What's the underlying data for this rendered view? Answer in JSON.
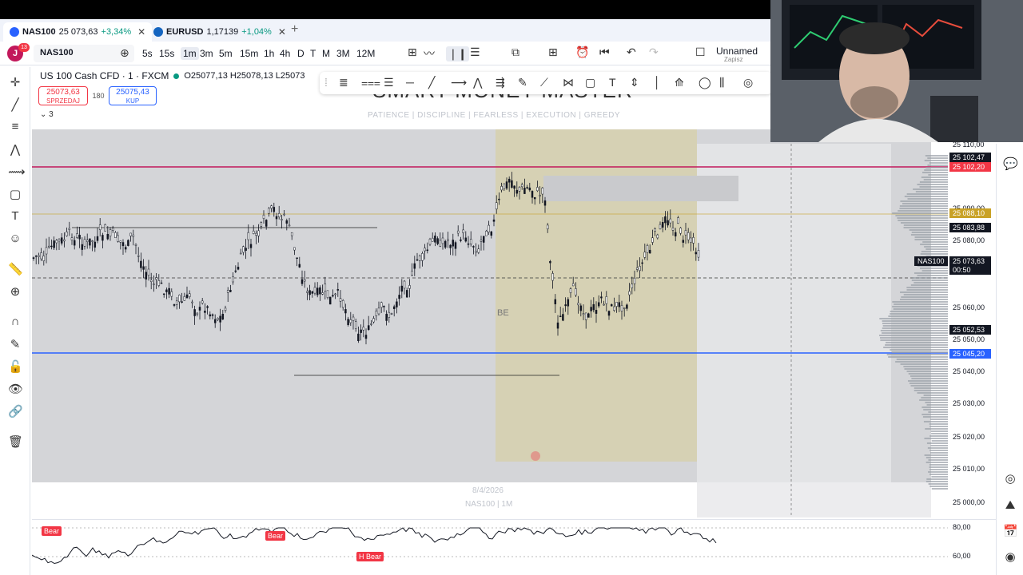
{
  "tabs": [
    {
      "symbol": "NAS100",
      "price": "25 073,63",
      "change": "+3,34%"
    },
    {
      "symbol": "EURUSD",
      "price": "1,17139",
      "change": "+1,04%"
    }
  ],
  "account": {
    "initial": "J",
    "badge": "13"
  },
  "toolbar": {
    "symbol": "NAS100",
    "intervals": [
      "5s",
      "15s",
      "1m",
      "3m",
      "5m",
      "15m",
      "1h",
      "4h",
      "D",
      "T",
      "M",
      "3M",
      "12M"
    ],
    "selected_interval": "1m",
    "layout_name": "Unnamed",
    "save_label": "Zapisz"
  },
  "legend": {
    "title": "US 100 Cash CFD · 1 · FXCM",
    "ohlc": "O25077,13 H25078,13 L25073",
    "sell_price": "25073,63",
    "sell_label": "SPRZEDAJ",
    "spread": "180",
    "buy_price": "25075,43",
    "buy_label": "KUP",
    "indicator_count": "3"
  },
  "watermark": {
    "title": "SMART MONEY MASTER",
    "subtitle": "PATIENCE  |  DISCIPLINE  |  FEARLESS  |  EXECUTION  |  GREEDY",
    "date": "8/4/2026",
    "symbol": "NAS100 | 1M"
  },
  "annotations": {
    "be": "BE"
  },
  "price_axis": {
    "labels": [
      "25 110,00",
      "25 090,00",
      "25 080,00",
      "25 060,00",
      "25 050,00",
      "25 040,00",
      "25 030,00",
      "25 020,00",
      "25 010,00",
      "25 000,00"
    ],
    "tags": [
      {
        "text": "25 102,47",
        "color": "#131722"
      },
      {
        "text": "25 102,20",
        "color": "#f23645"
      },
      {
        "text": "25 088,10",
        "color": "#c9a227"
      },
      {
        "text": "25 083,88",
        "color": "#131722"
      },
      {
        "text": "25 073,63",
        "color": "#131722"
      },
      {
        "text": "00:50",
        "color": "#131722"
      },
      {
        "text": "25 052,53",
        "color": "#131722"
      },
      {
        "text": "25 045,20",
        "color": "#2962ff"
      }
    ],
    "current_symbol": "NAS100"
  },
  "oscillator": {
    "labels": [
      "80,00",
      "60,00"
    ],
    "signals": [
      "Bear",
      "Bear",
      "H Bear"
    ]
  }
}
